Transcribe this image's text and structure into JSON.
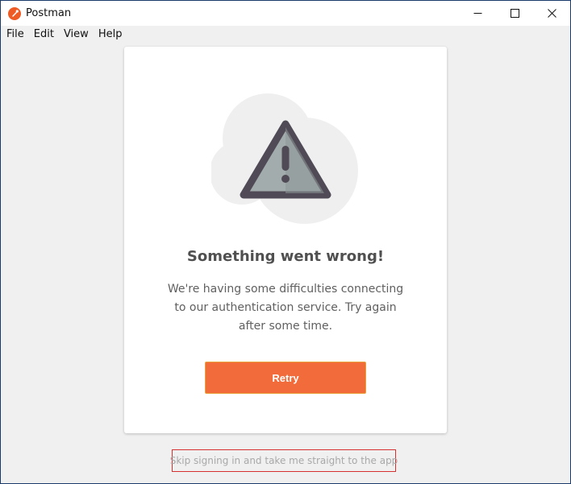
{
  "window": {
    "title": "Postman"
  },
  "menu": {
    "items": [
      "File",
      "Edit",
      "View",
      "Help"
    ]
  },
  "error": {
    "title": "Something went wrong!",
    "message": "We're having some difficulties connecting to our authentication service. Try again after some time.",
    "retry_label": "Retry"
  },
  "skip_link": {
    "label": "Skip signing in and take me straight to the app"
  },
  "icons": {
    "app": "postman-logo-icon",
    "minimize": "minimize-icon",
    "maximize": "maximize-icon",
    "close": "close-icon",
    "illustration": "warning-triangle-icon"
  },
  "colors": {
    "accent": "#f26b3a",
    "warning_fill": "#a3acad",
    "warning_stroke": "#4f4a55",
    "cloud": "#efefef"
  }
}
